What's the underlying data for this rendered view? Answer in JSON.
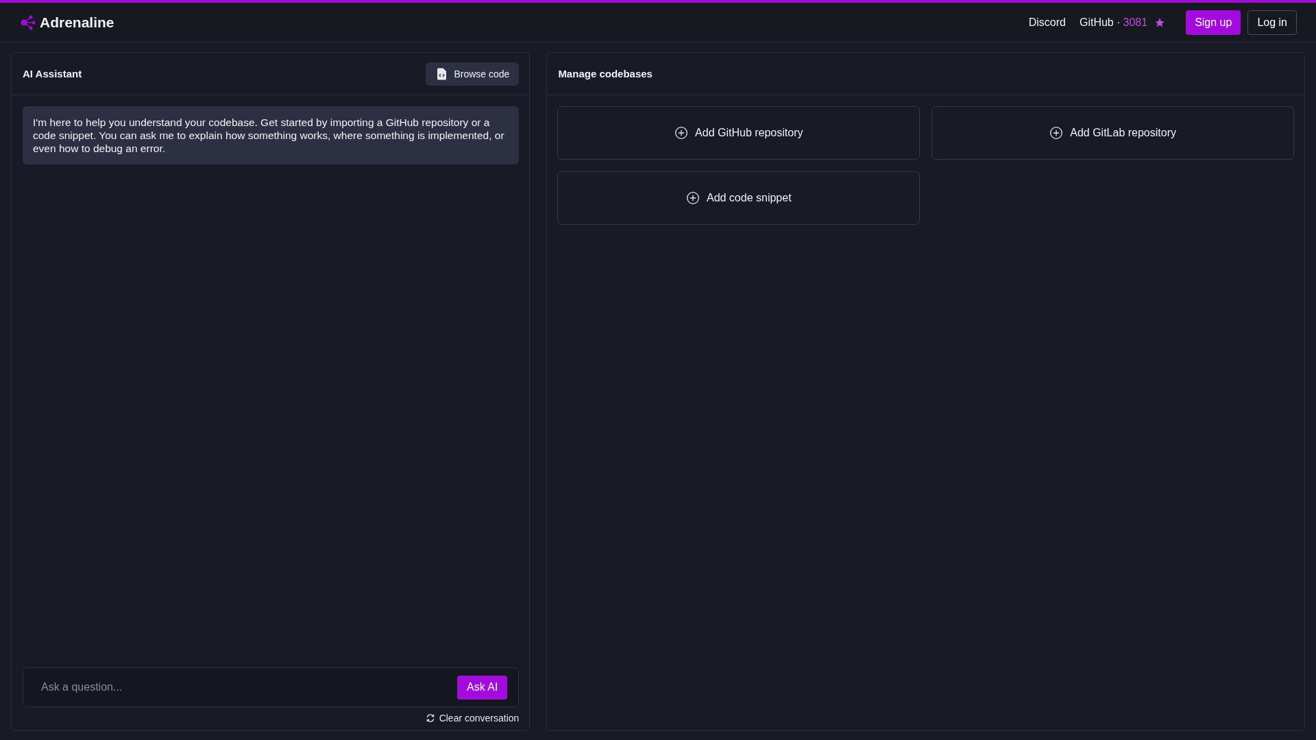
{
  "header": {
    "brand": "Adrenaline",
    "links": [
      {
        "kind": "link",
        "label": "Discord"
      },
      {
        "kind": "github",
        "label": "GitHub",
        "separator": "·",
        "stars_count": "3081"
      }
    ],
    "buttons": [
      {
        "kind": "primary",
        "label": "Sign up"
      },
      {
        "kind": "outline",
        "label": "Log in"
      }
    ]
  },
  "assistant": {
    "title": "AI Assistant",
    "browse_button": "Browse code",
    "messages": [
      "I'm here to help you understand your codebase. Get started by importing a GitHub repository or a code snippet. You can ask me to explain how something works, where something is implemented, or even how to debug an error."
    ],
    "input": {
      "placeholder": "Ask a question..."
    },
    "ask_button": "Ask AI",
    "clear_button": "Clear conversation"
  },
  "codebases": {
    "title": "Manage codebases",
    "actions": [
      "Add GitHub repository",
      "Add GitLab repository",
      "Add code snippet"
    ]
  }
}
